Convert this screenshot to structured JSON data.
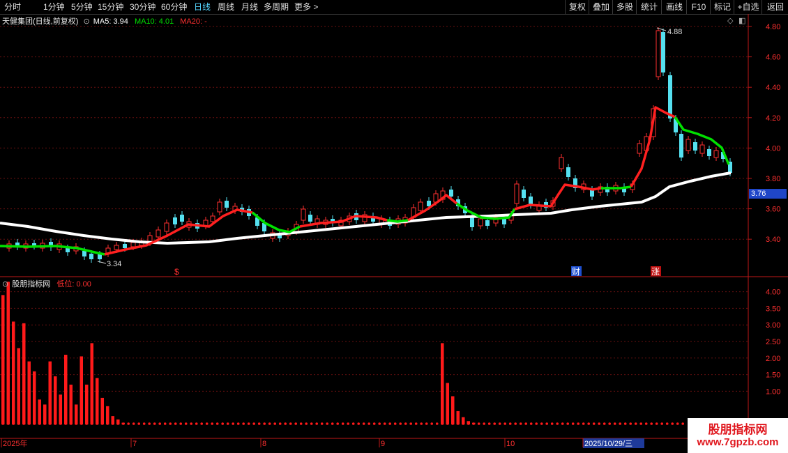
{
  "toolbar": {
    "periods": [
      "分时",
      "1分钟",
      "5分钟",
      "15分钟",
      "30分钟",
      "60分钟",
      "日线",
      "周线",
      "月线",
      "多周期",
      "更多 >"
    ],
    "active_period": "日线",
    "actions": [
      "复权",
      "叠加",
      "多股",
      "统计",
      "画线",
      "F10",
      "标记",
      "+自选",
      "返回"
    ]
  },
  "main_panel": {
    "stock_title": "天健集团(日线,前复权)",
    "ma5_label": "MA5: 3.94",
    "ma10_label": "MA10: 4.01",
    "ma20_label": "MA20: -",
    "ma5_color": "#ffffff",
    "ma10_color": "#00e000",
    "ma20_color": "#ff2020",
    "y_ticks": [
      "4.80",
      "4.60",
      "4.40",
      "4.20",
      "4.00",
      "3.80",
      "3.60",
      "3.40"
    ],
    "current_price": "3.76",
    "high_annotation": "4.88",
    "low_annotation": "3.34",
    "event_markers": [
      {
        "label": "$",
        "color": "#ff3030",
        "fill": "none"
      },
      {
        "label": "财",
        "color": "#ffffff",
        "fill": "#1e4fd0"
      },
      {
        "label": "涨",
        "color": "#ffffff",
        "fill": "#c01010"
      }
    ]
  },
  "indicator_panel": {
    "name": "股朋指标网",
    "value_label": "低位: 0.00",
    "y_ticks": [
      "4.00",
      "3.50",
      "3.00",
      "2.50",
      "2.00",
      "1.50",
      "1.00"
    ],
    "values": [
      3.9,
      4.3,
      3.1,
      2.3,
      3.05,
      1.9,
      1.6,
      0.75,
      0.6,
      1.9,
      1.45,
      0.9,
      2.1,
      1.2,
      0.6,
      2.05,
      1.2,
      2.45,
      1.4,
      0.8,
      0.55,
      0.25,
      0.15,
      0.05,
      0.02,
      0,
      0,
      0,
      0,
      0,
      0,
      0,
      0,
      0,
      0,
      0,
      0,
      0,
      0,
      0,
      0,
      0,
      0,
      0,
      0,
      0,
      0,
      0,
      0,
      0,
      0,
      0,
      0,
      0,
      0,
      0,
      0,
      0,
      0,
      0,
      0,
      0,
      0,
      0,
      0,
      0,
      0,
      0,
      0,
      0,
      0,
      0,
      0,
      0,
      0,
      0,
      0,
      0,
      0,
      0,
      0,
      0,
      0,
      0,
      2.45,
      1.25,
      0.85,
      0.4,
      0.22,
      0.1,
      0.05,
      0,
      0,
      0,
      0,
      0,
      0,
      0,
      0,
      0,
      0,
      0,
      0,
      0,
      0,
      0,
      0,
      0,
      0,
      0,
      0,
      0,
      0,
      0,
      0,
      0,
      0,
      0,
      0,
      0,
      0,
      0,
      0,
      0,
      0,
      0,
      0,
      0,
      0,
      0,
      0,
      0,
      0,
      0,
      0,
      0,
      0,
      0,
      0,
      0
    ]
  },
  "x_axis": {
    "labels": [
      "2025年",
      "7",
      "8",
      "9",
      "10",
      "2025/10/29/三"
    ]
  },
  "watermark": {
    "line1": "股朋指标网",
    "line2": "www.7gpzb.com"
  }
}
